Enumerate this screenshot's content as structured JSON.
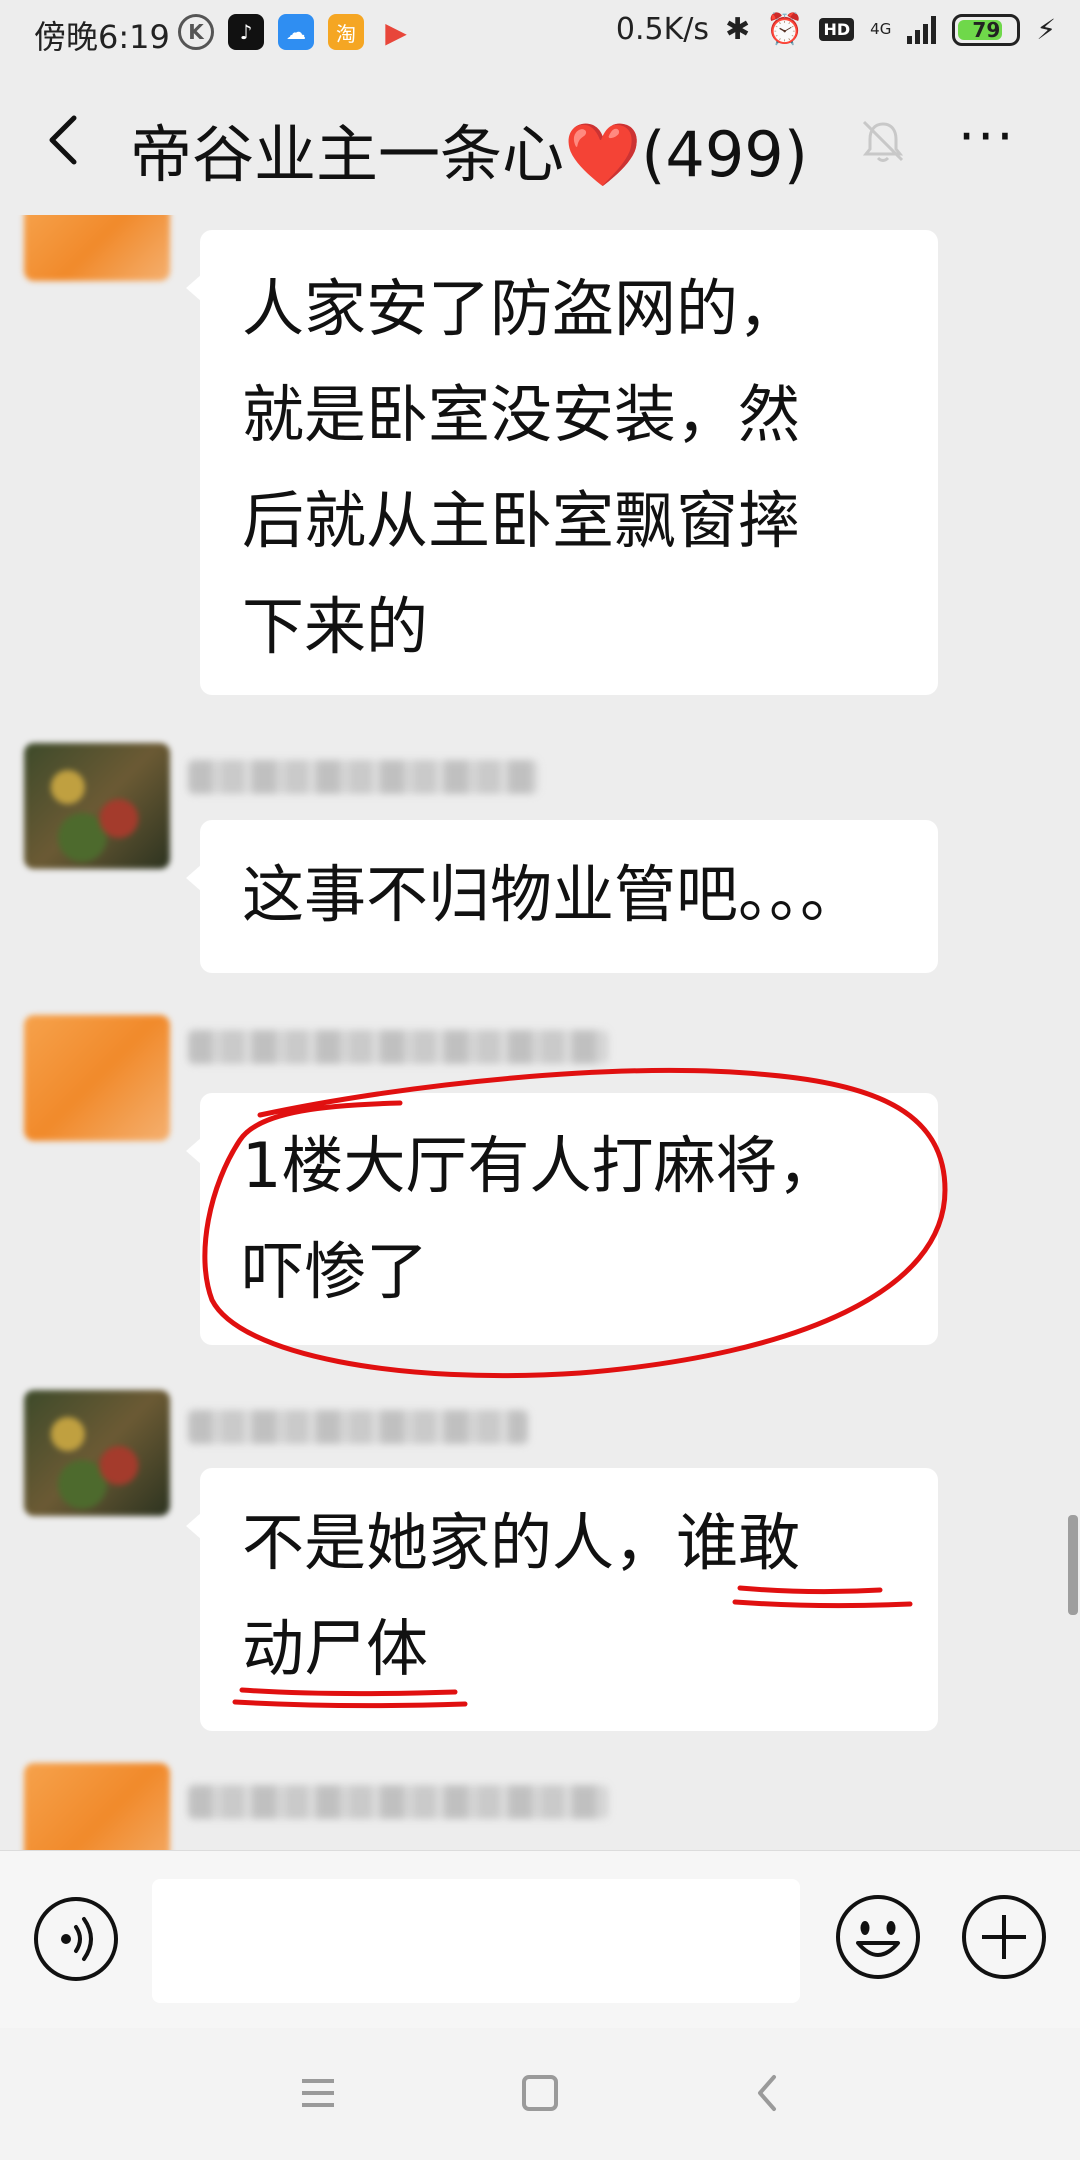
{
  "status_bar": {
    "time": "傍晚6:19",
    "net_speed": "0.5K/s",
    "hd_badge": "HD",
    "network_type": "4G",
    "battery_level": "79",
    "app_icons": [
      "k-icon",
      "tiktok-icon",
      "cloud-icon",
      "taobao-icon",
      "play-icon"
    ]
  },
  "header": {
    "title": "帝谷业主一条心❤️(499)",
    "back_icon": "chevron-left-icon",
    "mute_icon": "bell-off-icon",
    "more_label": "···"
  },
  "messages": [
    {
      "avatar": "orange-avatar",
      "text_lines": [
        "人家安了防盗网的，",
        "就是卧室没安装，然",
        "后就从主卧室飘窗摔",
        "下来的"
      ]
    },
    {
      "avatar": "photo-avatar",
      "text_lines": [
        "这事不归物业管吧。。。"
      ]
    },
    {
      "avatar": "orange-avatar",
      "text_lines": [
        "1楼大厅有人打麻将，",
        "吓惨了"
      ],
      "annotation": "red-circle"
    },
    {
      "avatar": "photo-avatar",
      "text_lines": [
        "不是她家的人，谁敢",
        "动尸体"
      ],
      "annotation": "red-underline"
    }
  ],
  "input_bar": {
    "voice_icon": "voice-icon",
    "emoji_icon": "emoji-icon",
    "plus_icon": "plus-icon",
    "placeholder": ""
  },
  "nav": {
    "items": [
      "menu-icon",
      "home-icon",
      "back-icon"
    ]
  },
  "colors": {
    "background": "#ededed",
    "bubble": "#ffffff",
    "annotation": "#e01010",
    "battery_fill": "#6fd84a"
  }
}
